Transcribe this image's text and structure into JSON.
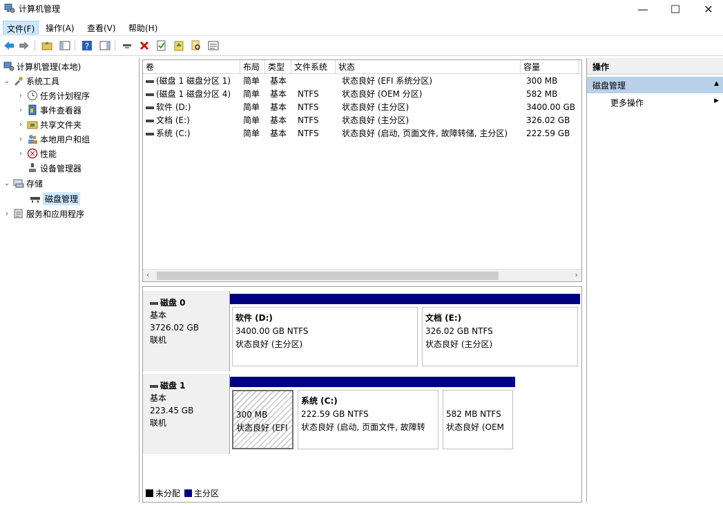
{
  "window": {
    "title": "计算机管理"
  },
  "menu": {
    "items": [
      "文件(F)",
      "操作(A)",
      "查看(V)",
      "帮助(H)"
    ]
  },
  "tree": {
    "root": "计算机管理(本地)",
    "system_tools": "系统工具",
    "task_scheduler": "任务计划程序",
    "event_viewer": "事件查看器",
    "shared_folders": "共享文件夹",
    "local_users": "本地用户和组",
    "performance": "性能",
    "device_manager": "设备管理器",
    "storage": "存储",
    "disk_management": "磁盘管理",
    "services_apps": "服务和应用程序"
  },
  "volume_list": {
    "columns": [
      "卷",
      "布局",
      "类型",
      "文件系统",
      "状态",
      "容量"
    ],
    "rows": [
      {
        "volume": "(磁盘 1 磁盘分区 1)",
        "layout": "简单",
        "type": "基本",
        "fs": "",
        "status": "状态良好 (EFI 系统分区)",
        "capacity": "300 MB"
      },
      {
        "volume": "(磁盘 1 磁盘分区 4)",
        "layout": "简单",
        "type": "基本",
        "fs": "NTFS",
        "status": "状态良好 (OEM 分区)",
        "capacity": "582 MB"
      },
      {
        "volume": "软件 (D:)",
        "layout": "简单",
        "type": "基本",
        "fs": "NTFS",
        "status": "状态良好 (主分区)",
        "capacity": "3400.00 GB"
      },
      {
        "volume": "文档 (E:)",
        "layout": "简单",
        "type": "基本",
        "fs": "NTFS",
        "status": "状态良好 (主分区)",
        "capacity": "326.02 GB"
      },
      {
        "volume": "系统 (C:)",
        "layout": "简单",
        "type": "基本",
        "fs": "NTFS",
        "status": "状态良好 (启动, 页面文件, 故障转储, 主分区)",
        "capacity": "222.59 GB"
      }
    ]
  },
  "disks": {
    "disk0": {
      "name": "磁盘 0",
      "type": "基本",
      "size": "3726.02 GB",
      "state": "联机",
      "d": {
        "name": "软件 (D:)",
        "size": "3400.00 GB NTFS",
        "status": "状态良好 (主分区)"
      },
      "e": {
        "name": "文档 (E:)",
        "size": "326.02 GB NTFS",
        "status": "状态良好 (主分区)"
      }
    },
    "disk1": {
      "name": "磁盘 1",
      "type": "基本",
      "size": "223.45 GB",
      "state": "联机",
      "efi": {
        "size": "300 MB",
        "status": "状态良好 (EFI"
      },
      "c": {
        "name": "系统 (C:)",
        "size": "222.59 GB NTFS",
        "status": "状态良好 (启动, 页面文件, 故障转"
      },
      "oem": {
        "size": "582 MB NTFS",
        "status": "状态良好 (OEM"
      }
    }
  },
  "legend": {
    "unallocated": "未分配",
    "primary": "主分区"
  },
  "actions": {
    "header": "操作",
    "section": "磁盘管理",
    "more": "更多操作"
  },
  "colors": {
    "primary_partition": "#000080",
    "unallocated": "#000000",
    "selection": "#cce8ff",
    "action_section": "#b9d1ea"
  }
}
